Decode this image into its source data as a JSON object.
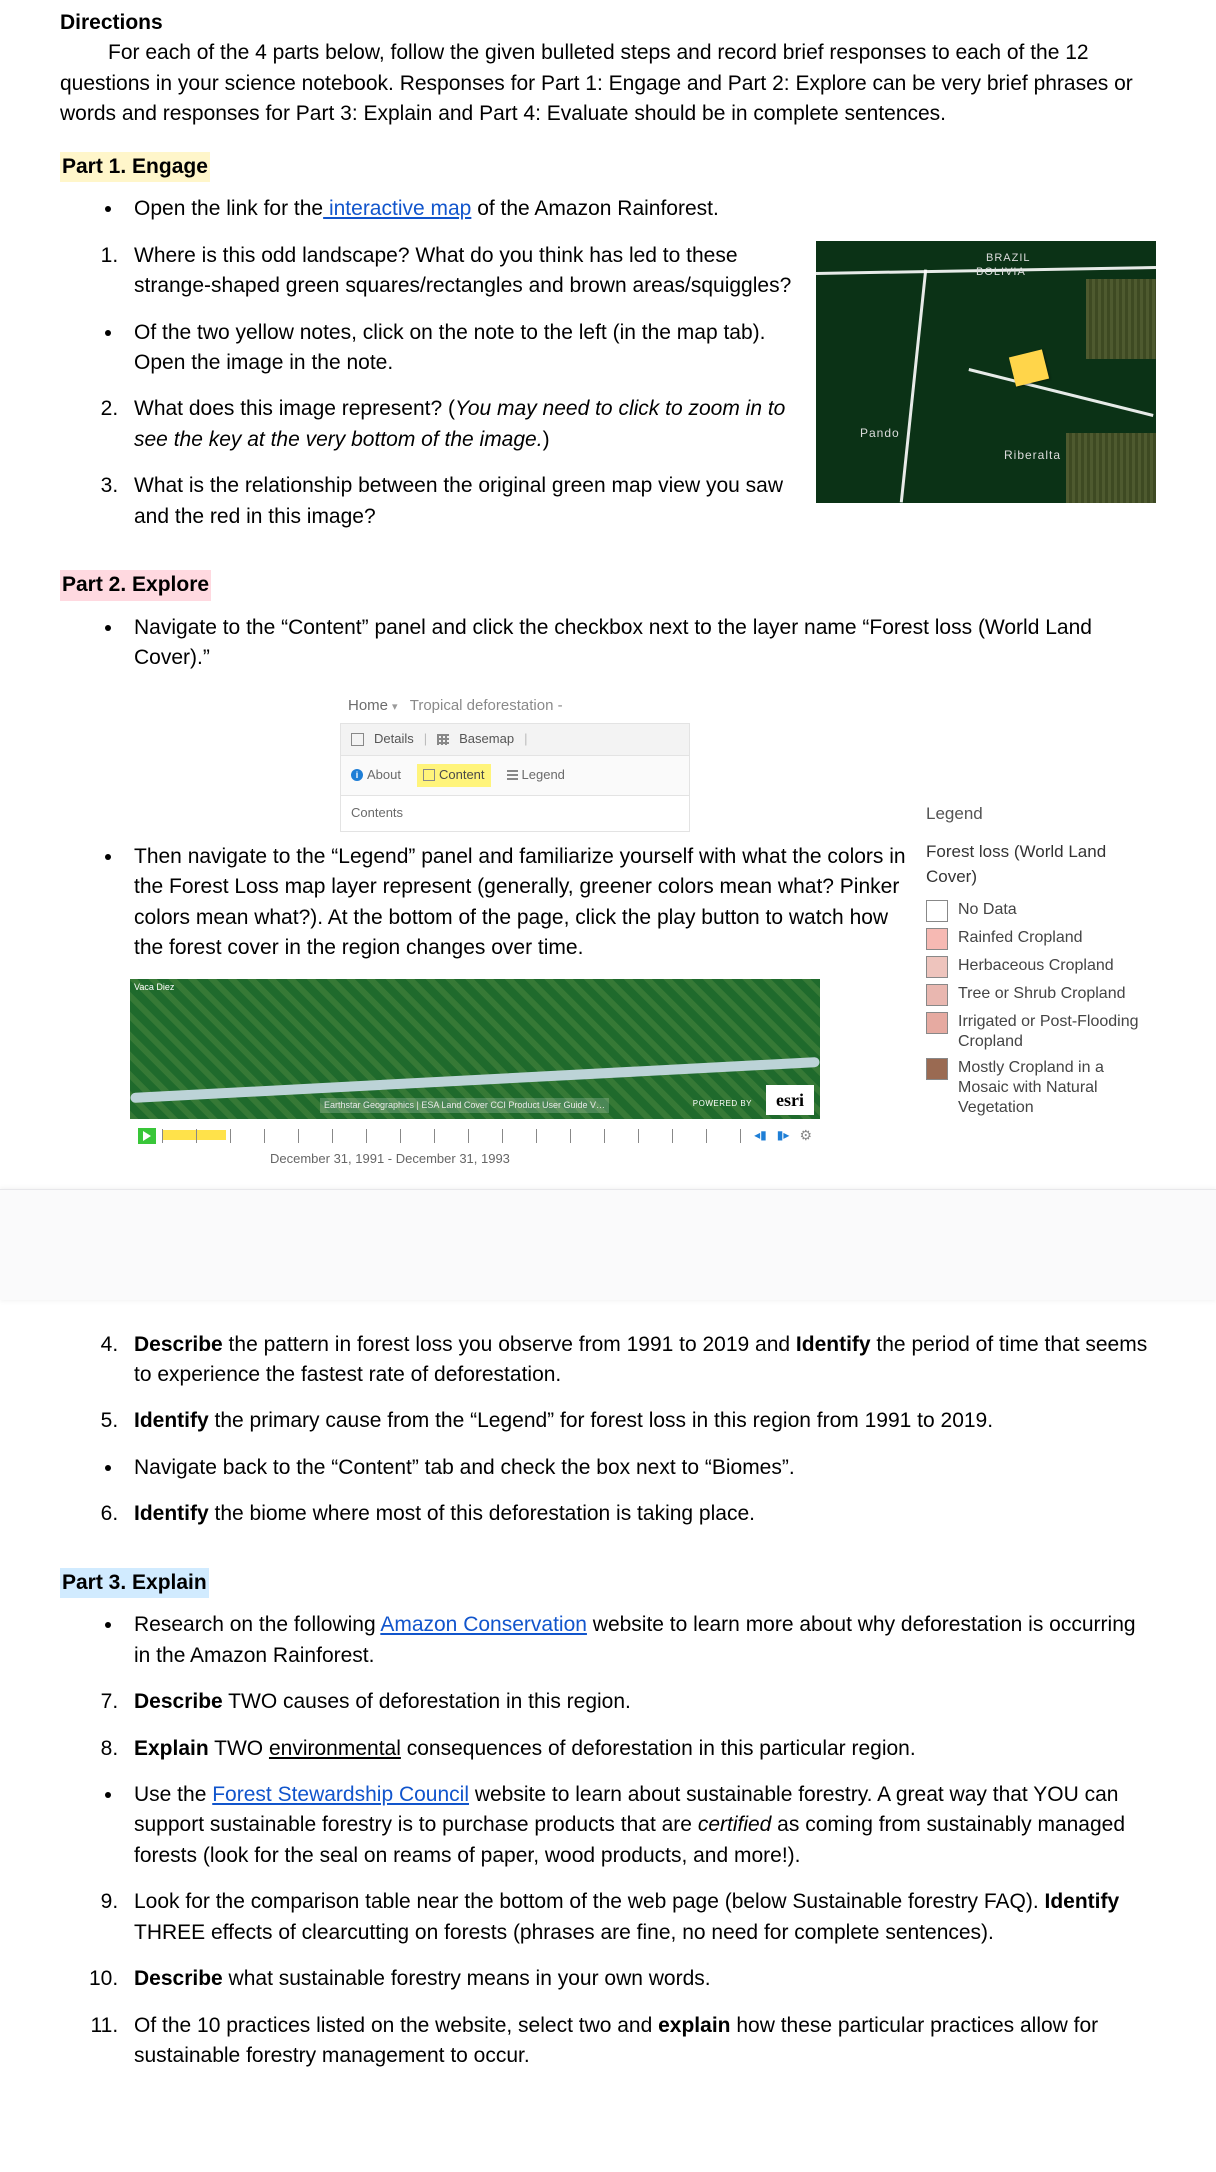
{
  "directions": {
    "heading": "Directions",
    "body": "For each of the 4 parts below, follow the given bulleted steps and record brief responses to each of the 12 questions in your science notebook.  Responses for Part 1: Engage and Part 2: Explore can be very brief phrases or words and responses for Part 3: Explain and Part 4: Evaluate should be in complete sentences."
  },
  "part1": {
    "heading": "Part 1. Engage",
    "bullet1_pre": "Open the link for the",
    "bullet1_link": " interactive map",
    "bullet1_post": " of the Amazon Rainforest.",
    "q1": "Where is this odd landscape? What do you think has led to these strange-shaped green squares/rectangles and brown areas/squiggles?",
    "bullet2": "Of the two yellow notes, click on the note to the left (in the map tab). Open the image in the note.",
    "q2_a": "What does this image represent? (",
    "q2_b": "You may need to click to zoom in to see the key at the very bottom of the image.",
    "q2_c": ")",
    "q3": "What is the relationship between the original green map view you saw and the red in this image?",
    "map": {
      "label_brazil": "BRAZIL",
      "label_bolivia": "BOLIVIA",
      "label_pando": "Pando",
      "label_riberalta": "Riberalta"
    }
  },
  "part2": {
    "heading": "Part 2. Explore",
    "bullet1": "Navigate to the “Content” panel and click the checkbox next to the layer name “Forest loss (World Land Cover).”",
    "panel": {
      "home": "Home",
      "title": "Tropical deforestation -",
      "details": "Details",
      "basemap": "Basemap",
      "about": "About",
      "content": "Content",
      "legend": "Legend",
      "contents": "Contents"
    },
    "bullet2": "Then navigate to the “Legend” panel and familiarize yourself with what the colors in the Forest Loss map layer represent (generally, greener colors mean what?  Pinker colors mean what?). At the bottom of the page, click the play button to watch how the forest cover in the region changes over time.",
    "legend": {
      "title": "Legend",
      "subtitle": "Forest loss (World Land Cover)",
      "items": [
        {
          "label": "No Data",
          "color": "#ffffff"
        },
        {
          "label": "Rainfed Cropland",
          "color": "#f6b9b3"
        },
        {
          "label": "Herbaceous Cropland",
          "color": "#eec4bd"
        },
        {
          "label": "Tree or Shrub Cropland",
          "color": "#e9b7b0"
        },
        {
          "label": "Irrigated or Post-Flooding Cropland",
          "color": "#e6aaa1"
        },
        {
          "label": "Mostly Cropland in a Mosaic with Natural Vegetation",
          "color": "#9a6a52"
        }
      ]
    },
    "slider": {
      "caption": "December 31, 1991 - December 31, 1993",
      "credit": "Earthstar Geographics | ESA Land Cover CCI Product User Guide V…",
      "powered": "POWERED BY",
      "esri": "esri",
      "corner": "Vaca Diez"
    },
    "q4_a": "Describe",
    "q4_b": " the pattern in forest loss you observe from 1991 to 2019 and ",
    "q4_c": "Identify",
    "q4_d": " the period of time that seems to experience the fastest rate of deforestation.",
    "q5_a": "Identify",
    "q5_b": " the primary cause from the “Legend” for forest loss in this region from 1991 to 2019.",
    "bullet3": "Navigate back to the “Content” tab and check the box next to “Biomes”.",
    "q6_a": "Identify",
    "q6_b": " the biome where most of this deforestation is taking place."
  },
  "part3": {
    "heading": "Part 3. Explain",
    "bullet1_pre": "Research on the following ",
    "bullet1_link": "Amazon Conservation",
    "bullet1_post": " website to learn more about why deforestation is occurring in the Amazon Rainforest.",
    "q7_a": "Describe",
    "q7_b": " TWO causes of deforestation in this region.",
    "q8_a": "Explain",
    "q8_b": " TWO ",
    "q8_c": "environmental",
    "q8_d": " consequences of deforestation in this particular region.",
    "bullet2_pre": "Use the ",
    "bullet2_link": "Forest Stewardship Council",
    "bullet2_mid": " website to learn about sustainable forestry. A great way that YOU can support sustainable forestry is to purchase products that are ",
    "bullet2_cert": "certified",
    "bullet2_post": " as coming from sustainably managed forests (look for the seal on reams of paper, wood products, and more!).",
    "q9_a": "Look for the comparison table near the bottom of the web page (below Sustainable forestry FAQ). ",
    "q9_b": "Identify",
    "q9_c": " THREE effects of clearcutting on forests (phrases are fine, no need for complete sentences).",
    "q10_a": "Describe",
    "q10_b": " what sustainable forestry means in your own words.",
    "q11_a": "Of the 10 practices listed on the website, select two and ",
    "q11_b": "explain",
    "q11_c": " how these particular practices allow for sustainable forestry management to occur."
  }
}
